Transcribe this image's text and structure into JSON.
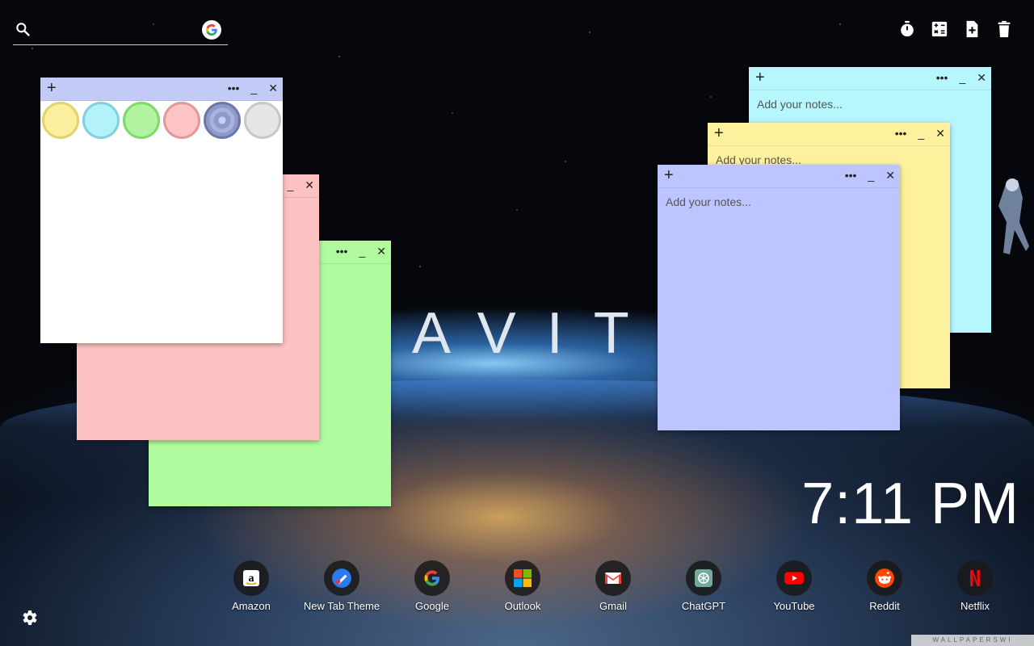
{
  "search": {
    "placeholder": ""
  },
  "brand_text": "AVIT",
  "toolbar": {
    "icons": [
      "timer-icon",
      "calculator-icon",
      "new-note-icon",
      "trash-icon"
    ]
  },
  "notes": [
    {
      "id": "white",
      "color": "#ffffff",
      "bar_color": "#c2cbf6",
      "placeholder": "",
      "swatches": [
        "#fbef9f",
        "#b4f2fb",
        "#b2f3a1",
        "#fcc4c4",
        "#8f9ac6",
        "#e6e6e6"
      ]
    },
    {
      "id": "pink",
      "color": "#fdc3c3",
      "placeholder": ""
    },
    {
      "id": "green",
      "color": "#b0fb9e",
      "placeholder": ""
    },
    {
      "id": "cyan",
      "color": "#b6f6fd",
      "placeholder": "Add your notes..."
    },
    {
      "id": "yellow",
      "color": "#fdf19e",
      "placeholder": "Add your notes..."
    },
    {
      "id": "blue",
      "color": "#bcc5fd",
      "placeholder": "Add your notes..."
    }
  ],
  "note_controls": {
    "add": "+",
    "menu": "•••",
    "minimize": "_",
    "close": "✕"
  },
  "clock": "7:11 PM",
  "shortcuts": [
    {
      "label": "Amazon",
      "icon": "amazon-icon"
    },
    {
      "label": "New Tab Theme",
      "icon": "new-tab-theme-icon"
    },
    {
      "label": "Google",
      "icon": "google-icon"
    },
    {
      "label": "Outlook",
      "icon": "outlook-icon"
    },
    {
      "label": "Gmail",
      "icon": "gmail-icon"
    },
    {
      "label": "ChatGPT",
      "icon": "chatgpt-icon"
    },
    {
      "label": "YouTube",
      "icon": "youtube-icon"
    },
    {
      "label": "Reddit",
      "icon": "reddit-icon"
    },
    {
      "label": "Netflix",
      "icon": "netflix-icon"
    }
  ],
  "watermark": "WALLPAPERSWI"
}
